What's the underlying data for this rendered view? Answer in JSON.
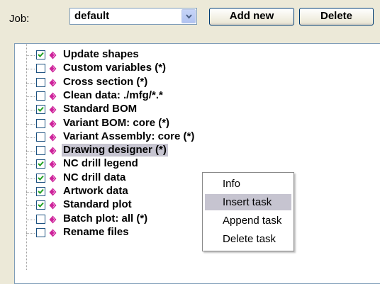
{
  "job": {
    "label": "Job:",
    "selected": "default",
    "add_label": "Add new",
    "delete_label": "Delete"
  },
  "tree": {
    "items": [
      {
        "label": "Update shapes",
        "checked": true
      },
      {
        "label": "Custom variables (*)",
        "checked": false
      },
      {
        "label": "Cross section (*)",
        "checked": false
      },
      {
        "label": "Clean data: ./mfg/*.*",
        "checked": false
      },
      {
        "label": "Standard BOM",
        "checked": true
      },
      {
        "label": "Variant BOM: core (*)",
        "checked": false
      },
      {
        "label": "Variant Assembly: core (*)",
        "checked": false
      },
      {
        "label": "Drawing designer (*)",
        "checked": false,
        "selected": true
      },
      {
        "label": "NC drill legend",
        "checked": true
      },
      {
        "label": "NC drill data",
        "checked": true
      },
      {
        "label": "Artwork data",
        "checked": true
      },
      {
        "label": "Standard plot",
        "checked": true
      },
      {
        "label": "Batch plot: all (*)",
        "checked": false
      },
      {
        "label": "Rename files",
        "checked": false
      }
    ]
  },
  "context_menu": {
    "items": [
      {
        "label": "Info"
      },
      {
        "label": "Insert task",
        "active": true
      },
      {
        "label": "Append task"
      },
      {
        "label": "Delete task"
      }
    ]
  },
  "colors": {
    "background": "#ece9d8",
    "task_icon": "#cc2299",
    "selection": "#c6c4d0"
  },
  "icons": {
    "task": "diamond-icon",
    "dropdown": "chevron-down-icon",
    "checkbox": "checkmark-icon"
  }
}
